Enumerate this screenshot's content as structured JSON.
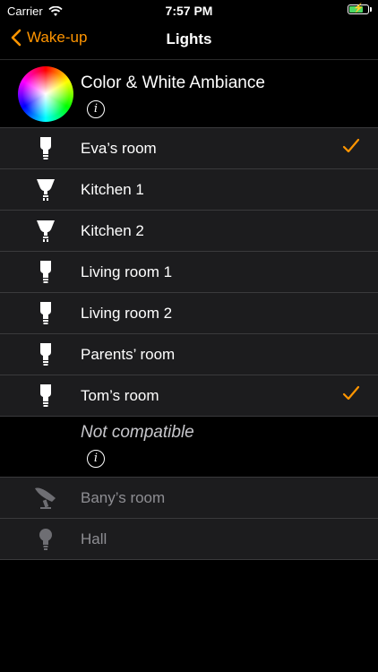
{
  "status": {
    "carrier": "Carrier",
    "time": "7:57 PM"
  },
  "nav": {
    "back_label": "Wake-up",
    "title": "Lights"
  },
  "header": {
    "name": "Color & White Ambiance"
  },
  "lights": [
    {
      "label": "Eva’s room",
      "checked": true
    },
    {
      "label": "Kitchen 1",
      "checked": false
    },
    {
      "label": "Kitchen 2",
      "checked": false
    },
    {
      "label": "Living room 1",
      "checked": false
    },
    {
      "label": "Living room 2",
      "checked": false
    },
    {
      "label": "Parents’ room",
      "checked": false
    },
    {
      "label": "Tom’s room",
      "checked": true
    }
  ],
  "not_compatible": {
    "label": "Not compatible",
    "items": [
      {
        "label": "Bany’s room",
        "icon": "lamp-icon"
      },
      {
        "label": "Hall",
        "icon": "bulb-icon"
      }
    ]
  },
  "colors": {
    "accent": "#ff9500",
    "row_bg": "#1c1c1e"
  }
}
